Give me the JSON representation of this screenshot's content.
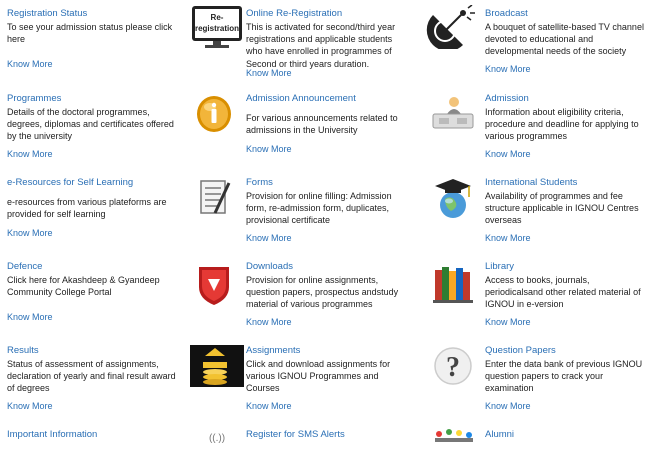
{
  "know_more": "Know More",
  "rows": [
    [
      {
        "title": "Registration Status",
        "desc": "To see your admission status please click here",
        "icon": "none"
      },
      {
        "title": "Online Re-Registration",
        "desc": "This is activated for second/third year registrations and applicable students who have enrolled in programmes of Second or third years duration.",
        "icon": "monitor-icon",
        "icon_text": [
          "Re-",
          "registration"
        ]
      },
      {
        "title": "Broadcast",
        "desc": "A bouquet of satellite-based TV channel devoted to educational and developmental needs of the society",
        "icon": "satellite-dish-icon"
      }
    ],
    [
      {
        "title": "Programmes",
        "desc": "Details of the doctoral programmes, degrees, diplomas and certificates offered by the university",
        "icon": "none"
      },
      {
        "title": "Admission Announcement",
        "desc": "For various announcements related to admissions in the University",
        "icon": "info-coin-icon"
      },
      {
        "title": "Admission",
        "desc": "Information about eligibility criteria, procedure and deadline for applying to various programmes",
        "icon": "desk-person-icon"
      }
    ],
    [
      {
        "title": "e-Resources for Self Learning",
        "desc": "e-resources from various plateforms are provided for self learning",
        "icon": "none"
      },
      {
        "title": "Forms",
        "desc": "Provision for online filling: Admission form, re-admission form, duplicates, provisional certificate",
        "icon": "form-clipboard-icon"
      },
      {
        "title": "International Students",
        "desc": "Availability of programmes and fee structure applicable in IGNOU Centres overseas",
        "icon": "graduation-globe-icon"
      }
    ],
    [
      {
        "title": "Defence",
        "desc": "Click here for Akashdeep & Gyandeep Community College Portal",
        "icon": "none"
      },
      {
        "title": "Downloads",
        "desc": "Provision for online assignments, question papers, prospectus andstudy material of various programmes",
        "icon": "download-shield-icon"
      },
      {
        "title": "Library",
        "desc": "Access to books, journals, periodicalsand other related material of IGNOU in e-version",
        "icon": "books-icon"
      }
    ],
    [
      {
        "title": "Results",
        "desc": "Status of assessment of assignments, declaration of yearly and final result award of degrees",
        "icon": "none"
      },
      {
        "title": "Assignments",
        "desc": "Click and download assignments for various IGNOU Programmes and Courses",
        "icon": "assignment-box-icon"
      },
      {
        "title": "Question Papers",
        "desc": "Enter the data bank of previous IGNOU question papers to crack your examination",
        "icon": "question-mark-icon"
      }
    ],
    [
      {
        "title": "Important Information",
        "desc": "",
        "icon": "none"
      },
      {
        "title": "Register for SMS Alerts",
        "desc": "",
        "icon": "signal-icon"
      },
      {
        "title": "Alumni",
        "desc": "",
        "icon": "people-icon"
      }
    ]
  ]
}
